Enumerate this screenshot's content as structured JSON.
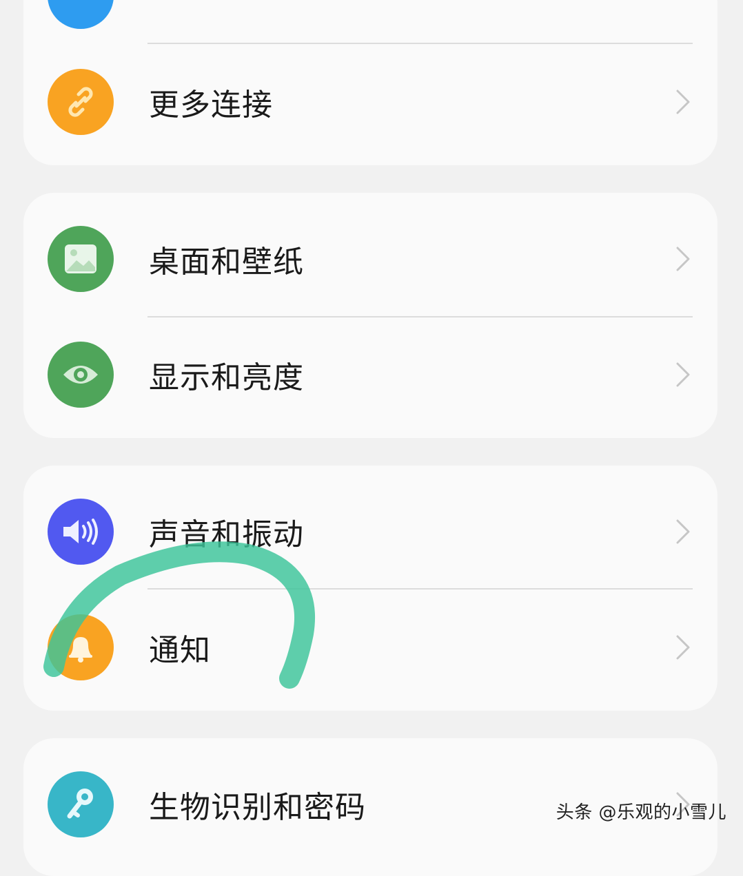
{
  "items": {
    "top_partial": {
      "label": "",
      "icon": "wifi-icon",
      "color": "#2e9cf0"
    },
    "more_connections": {
      "label": "更多连接",
      "icon": "link-icon",
      "color": "#f9a322"
    },
    "desktop_wallpaper": {
      "label": "桌面和壁纸",
      "icon": "image-icon",
      "color": "#4fa55a"
    },
    "display_brightness": {
      "label": "显示和亮度",
      "icon": "eye-icon",
      "color": "#4fa55a"
    },
    "sound_vibration": {
      "label": "声音和振动",
      "icon": "speaker-icon",
      "color": "#5159f0"
    },
    "notifications": {
      "label": "通知",
      "icon": "bell-icon",
      "color": "#f9a322"
    },
    "biometrics_password": {
      "label": "生物识别和密码",
      "icon": "key-icon",
      "color": "#38b6c8"
    }
  },
  "annotation": {
    "color": "#3cc49a"
  },
  "watermark": "头条 @乐观的小雪儿"
}
